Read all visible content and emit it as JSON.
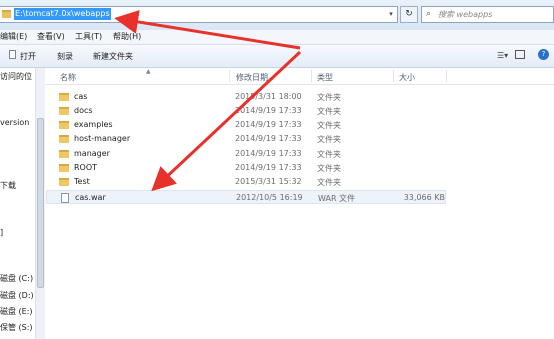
{
  "address_bar": {
    "path": "E:\\tomcat7.0x\\webapps",
    "search_placeholder": "搜索 webapps",
    "refresh_glyph": "↻",
    "dropdown_glyph": "▾"
  },
  "menu": [
    {
      "label": "编辑(E)"
    },
    {
      "label": "查看(V)"
    },
    {
      "label": "工具(T)"
    },
    {
      "label": "帮助(H)"
    }
  ],
  "toolbar": {
    "open_label": "打开",
    "burn_label": "刻录",
    "new_folder_label": "新建文件夹"
  },
  "nav_pane": [
    {
      "label": "访问的位"
    },
    {
      "label": "version"
    },
    {
      "label": "下载"
    },
    {
      "label": "]"
    },
    {
      "label": "磁盘 (C:)"
    },
    {
      "label": "磁盘 (D:)"
    },
    {
      "label": "磁盘 (E:)"
    },
    {
      "label": "保管 (S:)"
    }
  ],
  "columns": {
    "name": "名称",
    "date": "修改日期",
    "type": "类型",
    "size": "大小"
  },
  "files": [
    {
      "name": "cas",
      "date": "2015/3/31 18:00",
      "type": "文件夹",
      "size": "",
      "kind": "folder"
    },
    {
      "name": "docs",
      "date": "2014/9/19 17:33",
      "type": "文件夹",
      "size": "",
      "kind": "folder"
    },
    {
      "name": "examples",
      "date": "2014/9/19 17:33",
      "type": "文件夹",
      "size": "",
      "kind": "folder"
    },
    {
      "name": "host-manager",
      "date": "2014/9/19 17:33",
      "type": "文件夹",
      "size": "",
      "kind": "folder"
    },
    {
      "name": "manager",
      "date": "2014/9/19 17:33",
      "type": "文件夹",
      "size": "",
      "kind": "folder"
    },
    {
      "name": "ROOT",
      "date": "2014/9/19 17:33",
      "type": "文件夹",
      "size": "",
      "kind": "folder"
    },
    {
      "name": "Test",
      "date": "2015/3/31 15:32",
      "type": "文件夹",
      "size": "",
      "kind": "folder"
    },
    {
      "name": "cas.war",
      "date": "2012/10/5 16:19",
      "type": "WAR 文件",
      "size": "33,066 KB",
      "kind": "file"
    }
  ],
  "colors": {
    "annotation_arrow": "#e8312a",
    "selection": "#3399ff",
    "folder": "#efc766"
  }
}
